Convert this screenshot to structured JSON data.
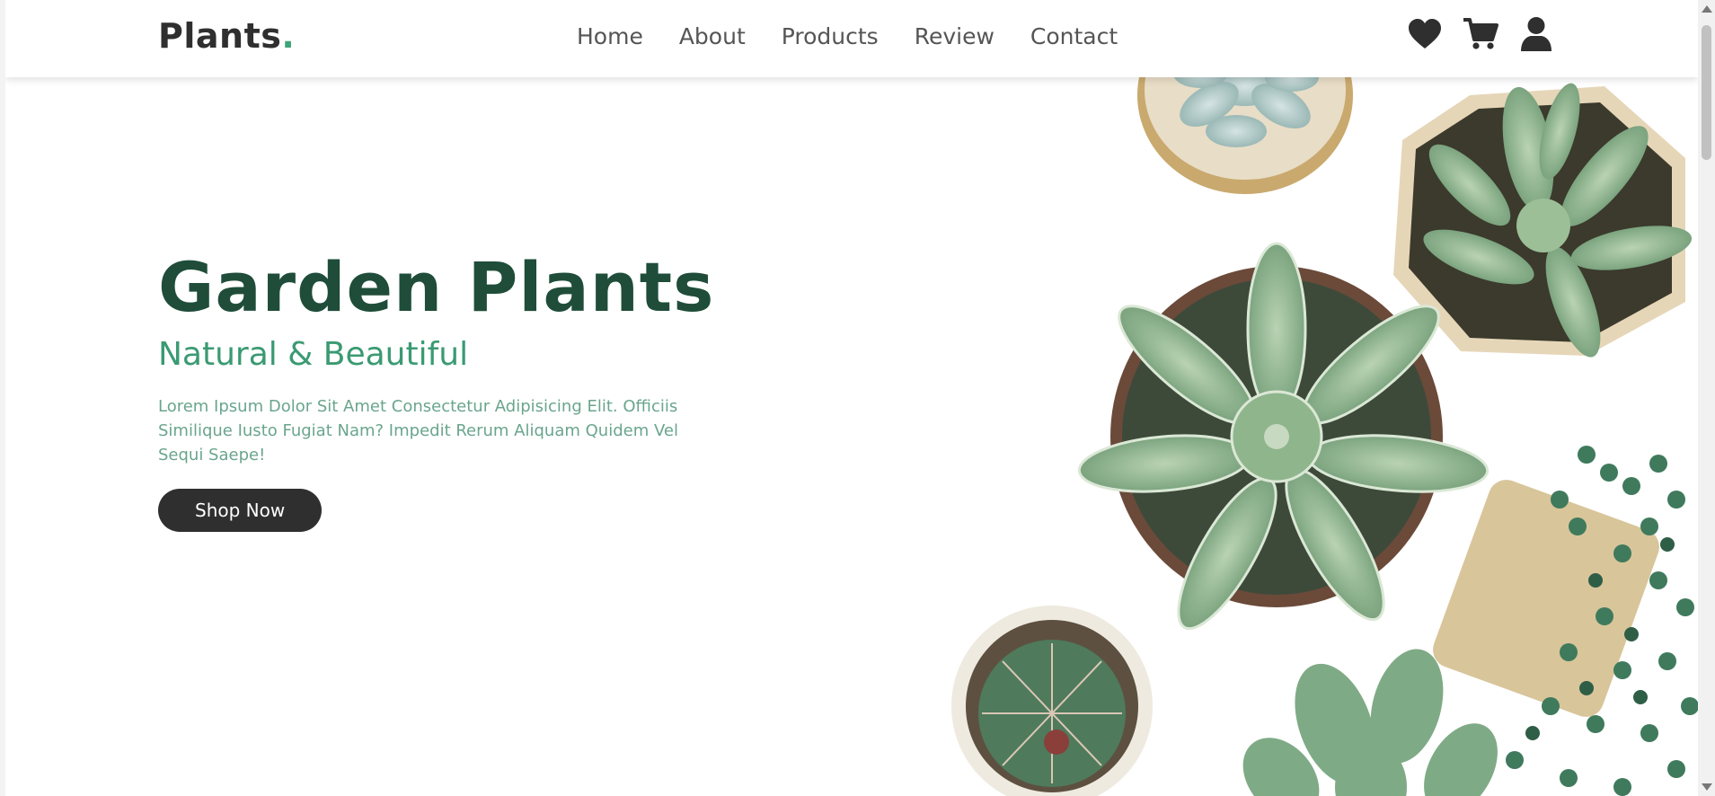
{
  "brand": {
    "name": "Plants",
    "dot": ".",
    "accent_color": "#3da57a"
  },
  "nav": {
    "items": [
      {
        "label": "Home"
      },
      {
        "label": "About"
      },
      {
        "label": "Products"
      },
      {
        "label": "Review"
      },
      {
        "label": "Contact"
      }
    ]
  },
  "header_icons": [
    "heart-icon",
    "cart-icon",
    "user-icon"
  ],
  "hero": {
    "title": "Garden Plants",
    "subtitle": "Natural & Beautiful",
    "description": "Lorem Ipsum Dolor Sit Amet Consectetur Adipisicing Elit. Officiis Similique Iusto Fugiat Nam? Impedit Rerum Aliquam Quidem Vel Sequi Saepe!",
    "cta_label": "Shop Now",
    "title_color": "#1f4d3a",
    "subtitle_color": "#3a9a72"
  }
}
